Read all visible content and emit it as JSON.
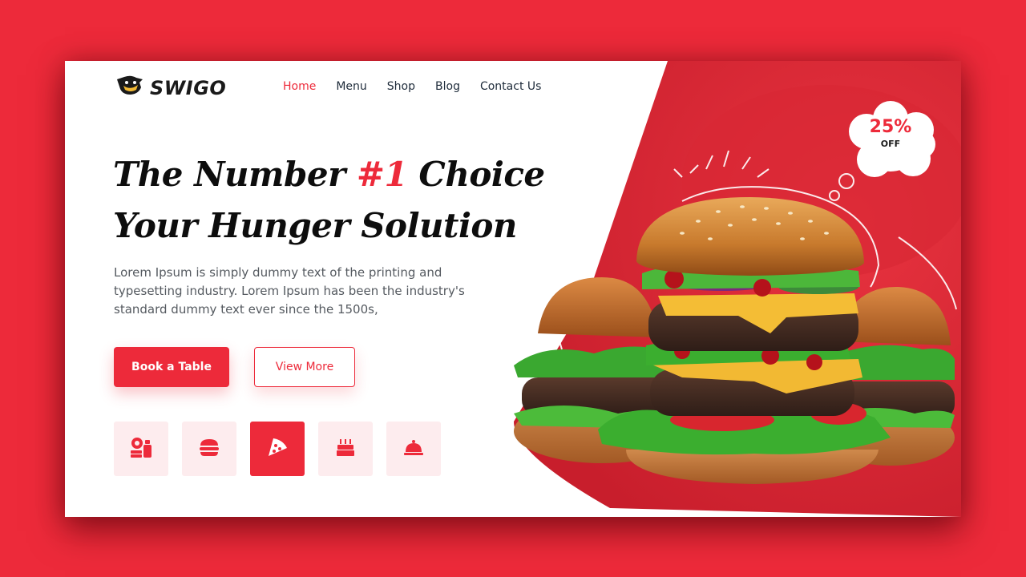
{
  "brand": {
    "name": "SWIGO",
    "logo_icon": "chef-hat-logo-icon"
  },
  "nav": [
    {
      "label": "Home",
      "active": true
    },
    {
      "label": "Menu",
      "active": false
    },
    {
      "label": "Shop",
      "active": false
    },
    {
      "label": "Blog",
      "active": false
    },
    {
      "label": "Contact Us",
      "active": false
    }
  ],
  "hero": {
    "title_line1_pre": "The Number ",
    "title_line1_accent": "#1",
    "title_line1_post": " Choice",
    "title_line2": "Your Hunger Solution",
    "description": "Lorem Ipsum is simply dummy text of the printing and typesetting industry. Lorem Ipsum has been the industry's standard dummy text ever since the 1500s,",
    "primary_button": "Book a Table",
    "secondary_button": "View More"
  },
  "categories": [
    {
      "icon": "fast-food-combo-icon",
      "active": false
    },
    {
      "icon": "burger-icon",
      "active": false
    },
    {
      "icon": "pizza-slice-icon",
      "active": true
    },
    {
      "icon": "birthday-cake-icon",
      "active": false
    },
    {
      "icon": "serving-cloche-icon",
      "active": false
    }
  ],
  "offer": {
    "percent": "25%",
    "label": "OFF"
  },
  "colors": {
    "accent": "#ed2a3a",
    "text_dark": "#0d0d0d",
    "nav_text": "#1e2b3a",
    "tile_bg": "#fdecee"
  }
}
